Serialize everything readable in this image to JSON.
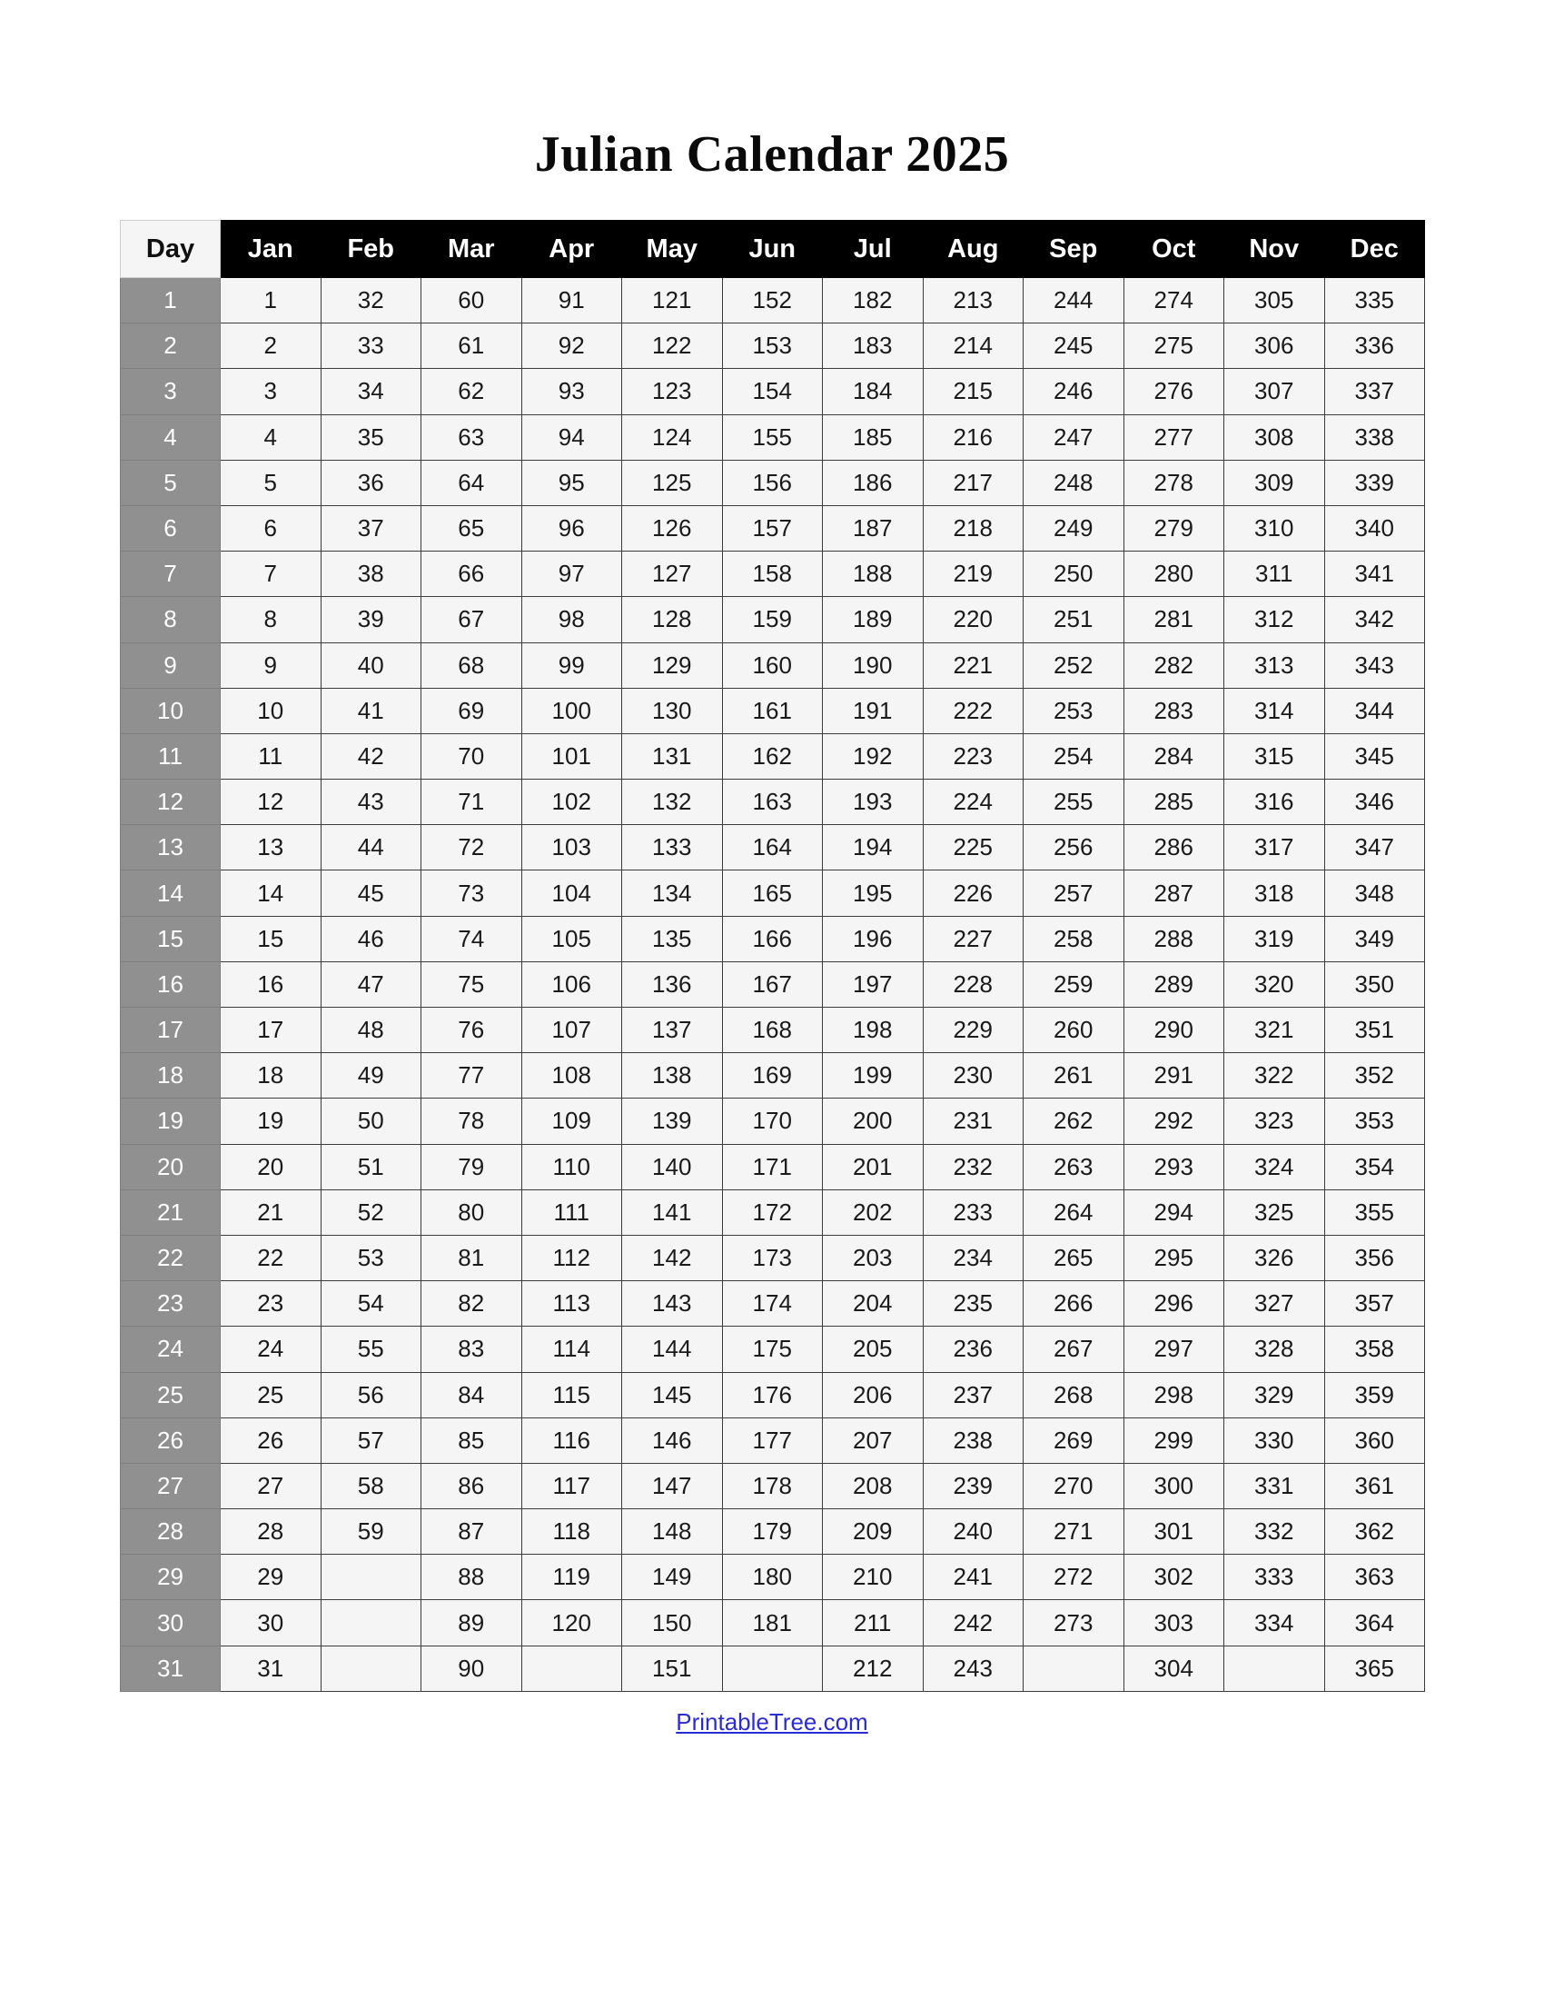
{
  "page": {
    "title": "Julian Calendar 2025",
    "background_color": "#ffffff"
  },
  "colors": {
    "header_bg": "#000000",
    "header_text": "#ffffff",
    "day_head_bg": "#f5f5f5",
    "day_col_bg": "#909090",
    "day_col_text": "#ffffff",
    "cell_bg": "#f5f5f5",
    "cell_text": "#1a1a1a",
    "link": "#2b2bd6"
  },
  "table": {
    "day_header": "Day",
    "months": [
      "Jan",
      "Feb",
      "Mar",
      "Apr",
      "May",
      "Jun",
      "Jul",
      "Aug",
      "Sep",
      "Oct",
      "Nov",
      "Dec"
    ],
    "rows": [
      {
        "day": "1",
        "values": [
          "1",
          "32",
          "60",
          "91",
          "121",
          "152",
          "182",
          "213",
          "244",
          "274",
          "305",
          "335"
        ]
      },
      {
        "day": "2",
        "values": [
          "2",
          "33",
          "61",
          "92",
          "122",
          "153",
          "183",
          "214",
          "245",
          "275",
          "306",
          "336"
        ]
      },
      {
        "day": "3",
        "values": [
          "3",
          "34",
          "62",
          "93",
          "123",
          "154",
          "184",
          "215",
          "246",
          "276",
          "307",
          "337"
        ]
      },
      {
        "day": "4",
        "values": [
          "4",
          "35",
          "63",
          "94",
          "124",
          "155",
          "185",
          "216",
          "247",
          "277",
          "308",
          "338"
        ]
      },
      {
        "day": "5",
        "values": [
          "5",
          "36",
          "64",
          "95",
          "125",
          "156",
          "186",
          "217",
          "248",
          "278",
          "309",
          "339"
        ]
      },
      {
        "day": "6",
        "values": [
          "6",
          "37",
          "65",
          "96",
          "126",
          "157",
          "187",
          "218",
          "249",
          "279",
          "310",
          "340"
        ]
      },
      {
        "day": "7",
        "values": [
          "7",
          "38",
          "66",
          "97",
          "127",
          "158",
          "188",
          "219",
          "250",
          "280",
          "311",
          "341"
        ]
      },
      {
        "day": "8",
        "values": [
          "8",
          "39",
          "67",
          "98",
          "128",
          "159",
          "189",
          "220",
          "251",
          "281",
          "312",
          "342"
        ]
      },
      {
        "day": "9",
        "values": [
          "9",
          "40",
          "68",
          "99",
          "129",
          "160",
          "190",
          "221",
          "252",
          "282",
          "313",
          "343"
        ]
      },
      {
        "day": "10",
        "values": [
          "10",
          "41",
          "69",
          "100",
          "130",
          "161",
          "191",
          "222",
          "253",
          "283",
          "314",
          "344"
        ]
      },
      {
        "day": "11",
        "values": [
          "11",
          "42",
          "70",
          "101",
          "131",
          "162",
          "192",
          "223",
          "254",
          "284",
          "315",
          "345"
        ]
      },
      {
        "day": "12",
        "values": [
          "12",
          "43",
          "71",
          "102",
          "132",
          "163",
          "193",
          "224",
          "255",
          "285",
          "316",
          "346"
        ]
      },
      {
        "day": "13",
        "values": [
          "13",
          "44",
          "72",
          "103",
          "133",
          "164",
          "194",
          "225",
          "256",
          "286",
          "317",
          "347"
        ]
      },
      {
        "day": "14",
        "values": [
          "14",
          "45",
          "73",
          "104",
          "134",
          "165",
          "195",
          "226",
          "257",
          "287",
          "318",
          "348"
        ]
      },
      {
        "day": "15",
        "values": [
          "15",
          "46",
          "74",
          "105",
          "135",
          "166",
          "196",
          "227",
          "258",
          "288",
          "319",
          "349"
        ]
      },
      {
        "day": "16",
        "values": [
          "16",
          "47",
          "75",
          "106",
          "136",
          "167",
          "197",
          "228",
          "259",
          "289",
          "320",
          "350"
        ]
      },
      {
        "day": "17",
        "values": [
          "17",
          "48",
          "76",
          "107",
          "137",
          "168",
          "198",
          "229",
          "260",
          "290",
          "321",
          "351"
        ]
      },
      {
        "day": "18",
        "values": [
          "18",
          "49",
          "77",
          "108",
          "138",
          "169",
          "199",
          "230",
          "261",
          "291",
          "322",
          "352"
        ]
      },
      {
        "day": "19",
        "values": [
          "19",
          "50",
          "78",
          "109",
          "139",
          "170",
          "200",
          "231",
          "262",
          "292",
          "323",
          "353"
        ]
      },
      {
        "day": "20",
        "values": [
          "20",
          "51",
          "79",
          "110",
          "140",
          "171",
          "201",
          "232",
          "263",
          "293",
          "324",
          "354"
        ]
      },
      {
        "day": "21",
        "values": [
          "21",
          "52",
          "80",
          "111",
          "141",
          "172",
          "202",
          "233",
          "264",
          "294",
          "325",
          "355"
        ]
      },
      {
        "day": "22",
        "values": [
          "22",
          "53",
          "81",
          "112",
          "142",
          "173",
          "203",
          "234",
          "265",
          "295",
          "326",
          "356"
        ]
      },
      {
        "day": "23",
        "values": [
          "23",
          "54",
          "82",
          "113",
          "143",
          "174",
          "204",
          "235",
          "266",
          "296",
          "327",
          "357"
        ]
      },
      {
        "day": "24",
        "values": [
          "24",
          "55",
          "83",
          "114",
          "144",
          "175",
          "205",
          "236",
          "267",
          "297",
          "328",
          "358"
        ]
      },
      {
        "day": "25",
        "values": [
          "25",
          "56",
          "84",
          "115",
          "145",
          "176",
          "206",
          "237",
          "268",
          "298",
          "329",
          "359"
        ]
      },
      {
        "day": "26",
        "values": [
          "26",
          "57",
          "85",
          "116",
          "146",
          "177",
          "207",
          "238",
          "269",
          "299",
          "330",
          "360"
        ]
      },
      {
        "day": "27",
        "values": [
          "27",
          "58",
          "86",
          "117",
          "147",
          "178",
          "208",
          "239",
          "270",
          "300",
          "331",
          "361"
        ]
      },
      {
        "day": "28",
        "values": [
          "28",
          "59",
          "87",
          "118",
          "148",
          "179",
          "209",
          "240",
          "271",
          "301",
          "332",
          "362"
        ]
      },
      {
        "day": "29",
        "values": [
          "29",
          "",
          "88",
          "119",
          "149",
          "180",
          "210",
          "241",
          "272",
          "302",
          "333",
          "363"
        ]
      },
      {
        "day": "30",
        "values": [
          "30",
          "",
          "89",
          "120",
          "150",
          "181",
          "211",
          "242",
          "273",
          "303",
          "334",
          "364"
        ]
      },
      {
        "day": "31",
        "values": [
          "31",
          "",
          "90",
          "",
          "151",
          "",
          "212",
          "243",
          "",
          "304",
          "",
          "365"
        ]
      }
    ]
  },
  "footer": {
    "link_label": "PrintableTree.com"
  }
}
